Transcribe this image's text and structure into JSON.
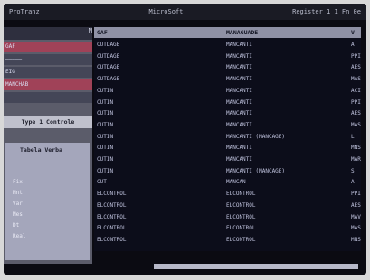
{
  "topbar": {
    "left": "ProTranz",
    "center": "MicroSoft",
    "right": "Register 1 1 Fn 0e"
  },
  "sidebar": {
    "header": "M",
    "rows": [
      {
        "label": "GAF",
        "style": "red"
      },
      {
        "label": "—————",
        "style": "dark"
      },
      {
        "label": "EIG",
        "style": "dark"
      },
      {
        "label": "MANCHAB",
        "style": "red"
      },
      {
        "label": "",
        "style": "dark"
      }
    ],
    "caption": "Type 1 Controle",
    "panel_caption": "Tabela Verba",
    "panel_labels": [
      "Fix",
      "Mnt",
      "Var",
      "Mes",
      "Dt",
      "Real"
    ]
  },
  "table": {
    "headers": [
      "GAF",
      "MANAGUADE",
      "V"
    ],
    "rows": [
      [
        "CUTDAGE",
        "MANCANTI",
        "A"
      ],
      [
        "CUTDAGE",
        "MANCANTI",
        "PPI"
      ],
      [
        "CUTDAGE",
        "MANCANTI",
        "AES"
      ],
      [
        "CUTDAGE",
        "MANCANTI",
        "MAS"
      ],
      [
        "CUTIN",
        "MANCANTI",
        "ACI"
      ],
      [
        "CUTIN",
        "MANCANTI",
        "PPI"
      ],
      [
        "CUTIN",
        "MANCANTI",
        "AES"
      ],
      [
        "CUTIN",
        "MANCANTI",
        "MAS"
      ],
      [
        "CUTIN",
        "MANCANTI (MANCAGE)",
        "L"
      ],
      [
        "CUTIN",
        "MANCANTI",
        "MNS"
      ],
      [
        "CUTIN",
        "MANCANTI",
        "MAR"
      ],
      [
        "CUTIN",
        "MANCANTI (MANCAGE)",
        "S"
      ],
      [
        "CUT",
        "MANCAN",
        "A"
      ],
      [
        "ELCONTROL",
        "ELCONTROL",
        "PPI"
      ],
      [
        "ELCONTROL",
        "ELCONTROL",
        "AES"
      ],
      [
        "ELCONTROL",
        "ELCONTROL",
        "MAV"
      ],
      [
        "ELCONTROL",
        "ELCONTROL",
        "MAS"
      ],
      [
        "ELCONTROL",
        "ELCONTROL",
        "MNS"
      ]
    ]
  },
  "colors": {
    "screen": "#0b0b12",
    "accent": "#a04258",
    "header": "#8f91a5"
  }
}
